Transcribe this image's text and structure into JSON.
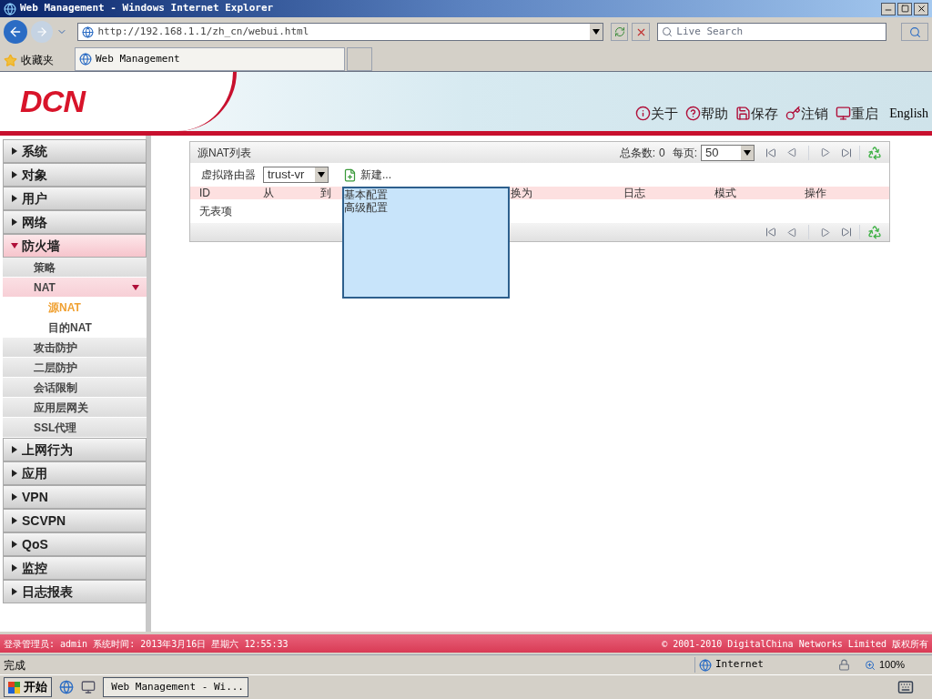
{
  "browser": {
    "title": "Web Management - Windows Internet Explorer",
    "address": "http://192.168.1.1/zh_cn/webui.html",
    "search_placeholder": "Live Search",
    "favorites": "收藏夹",
    "tab_title": "Web Management"
  },
  "header": {
    "logo": "DCN",
    "actions": [
      {
        "kind": "about",
        "label": "关于"
      },
      {
        "kind": "help",
        "label": "帮助"
      },
      {
        "kind": "save",
        "label": "保存"
      },
      {
        "kind": "logout",
        "label": "注销"
      },
      {
        "kind": "restart",
        "label": "重启"
      }
    ],
    "language": "English"
  },
  "sidebar": [
    {
      "label": "系统",
      "expanded": false
    },
    {
      "label": "对象",
      "expanded": false
    },
    {
      "label": "用户",
      "expanded": false
    },
    {
      "label": "网络",
      "expanded": false
    },
    {
      "label": "防火墙",
      "expanded": true,
      "children": [
        {
          "label": "策略"
        },
        {
          "label": "NAT",
          "expanded": true,
          "children": [
            {
              "label": "源NAT",
              "selected": true
            },
            {
              "label": "目的NAT",
              "selected": false
            }
          ]
        },
        {
          "label": "攻击防护"
        },
        {
          "label": "二层防护"
        },
        {
          "label": "会话限制"
        },
        {
          "label": "应用层网关"
        },
        {
          "label": "SSL代理"
        }
      ]
    },
    {
      "label": "上网行为",
      "expanded": false
    },
    {
      "label": "应用",
      "expanded": false
    },
    {
      "label": "VPN",
      "expanded": false
    },
    {
      "label": "SCVPN",
      "expanded": false
    },
    {
      "label": "QoS",
      "expanded": false
    },
    {
      "label": "监控",
      "expanded": false
    },
    {
      "label": "日志报表",
      "expanded": false
    }
  ],
  "panel": {
    "title": "源NAT列表",
    "total_label": "总条数:",
    "total": "0",
    "per_page_label": "每页:",
    "per_page": "50",
    "vrouter_label": "虚拟路由器",
    "vrouter": "trust-vr",
    "new_button": "新建...",
    "columns": [
      "ID",
      "从",
      "到",
      "换为",
      "日志",
      "模式",
      "操作"
    ],
    "empty_text": "无表项"
  },
  "popup": {
    "items": [
      "基本配置",
      "高级配置"
    ]
  },
  "footer": {
    "left": "登录管理员: admin 系统时间: 2013年3月16日 星期六 12:55:33",
    "right": "© 2001-2010 DigitalChina Networks Limited 版权所有"
  },
  "status": {
    "text": "完成",
    "zone": "Internet",
    "zoom": "100%"
  },
  "taskbar": {
    "start": "开始",
    "window": "Web Management - Wi..."
  }
}
